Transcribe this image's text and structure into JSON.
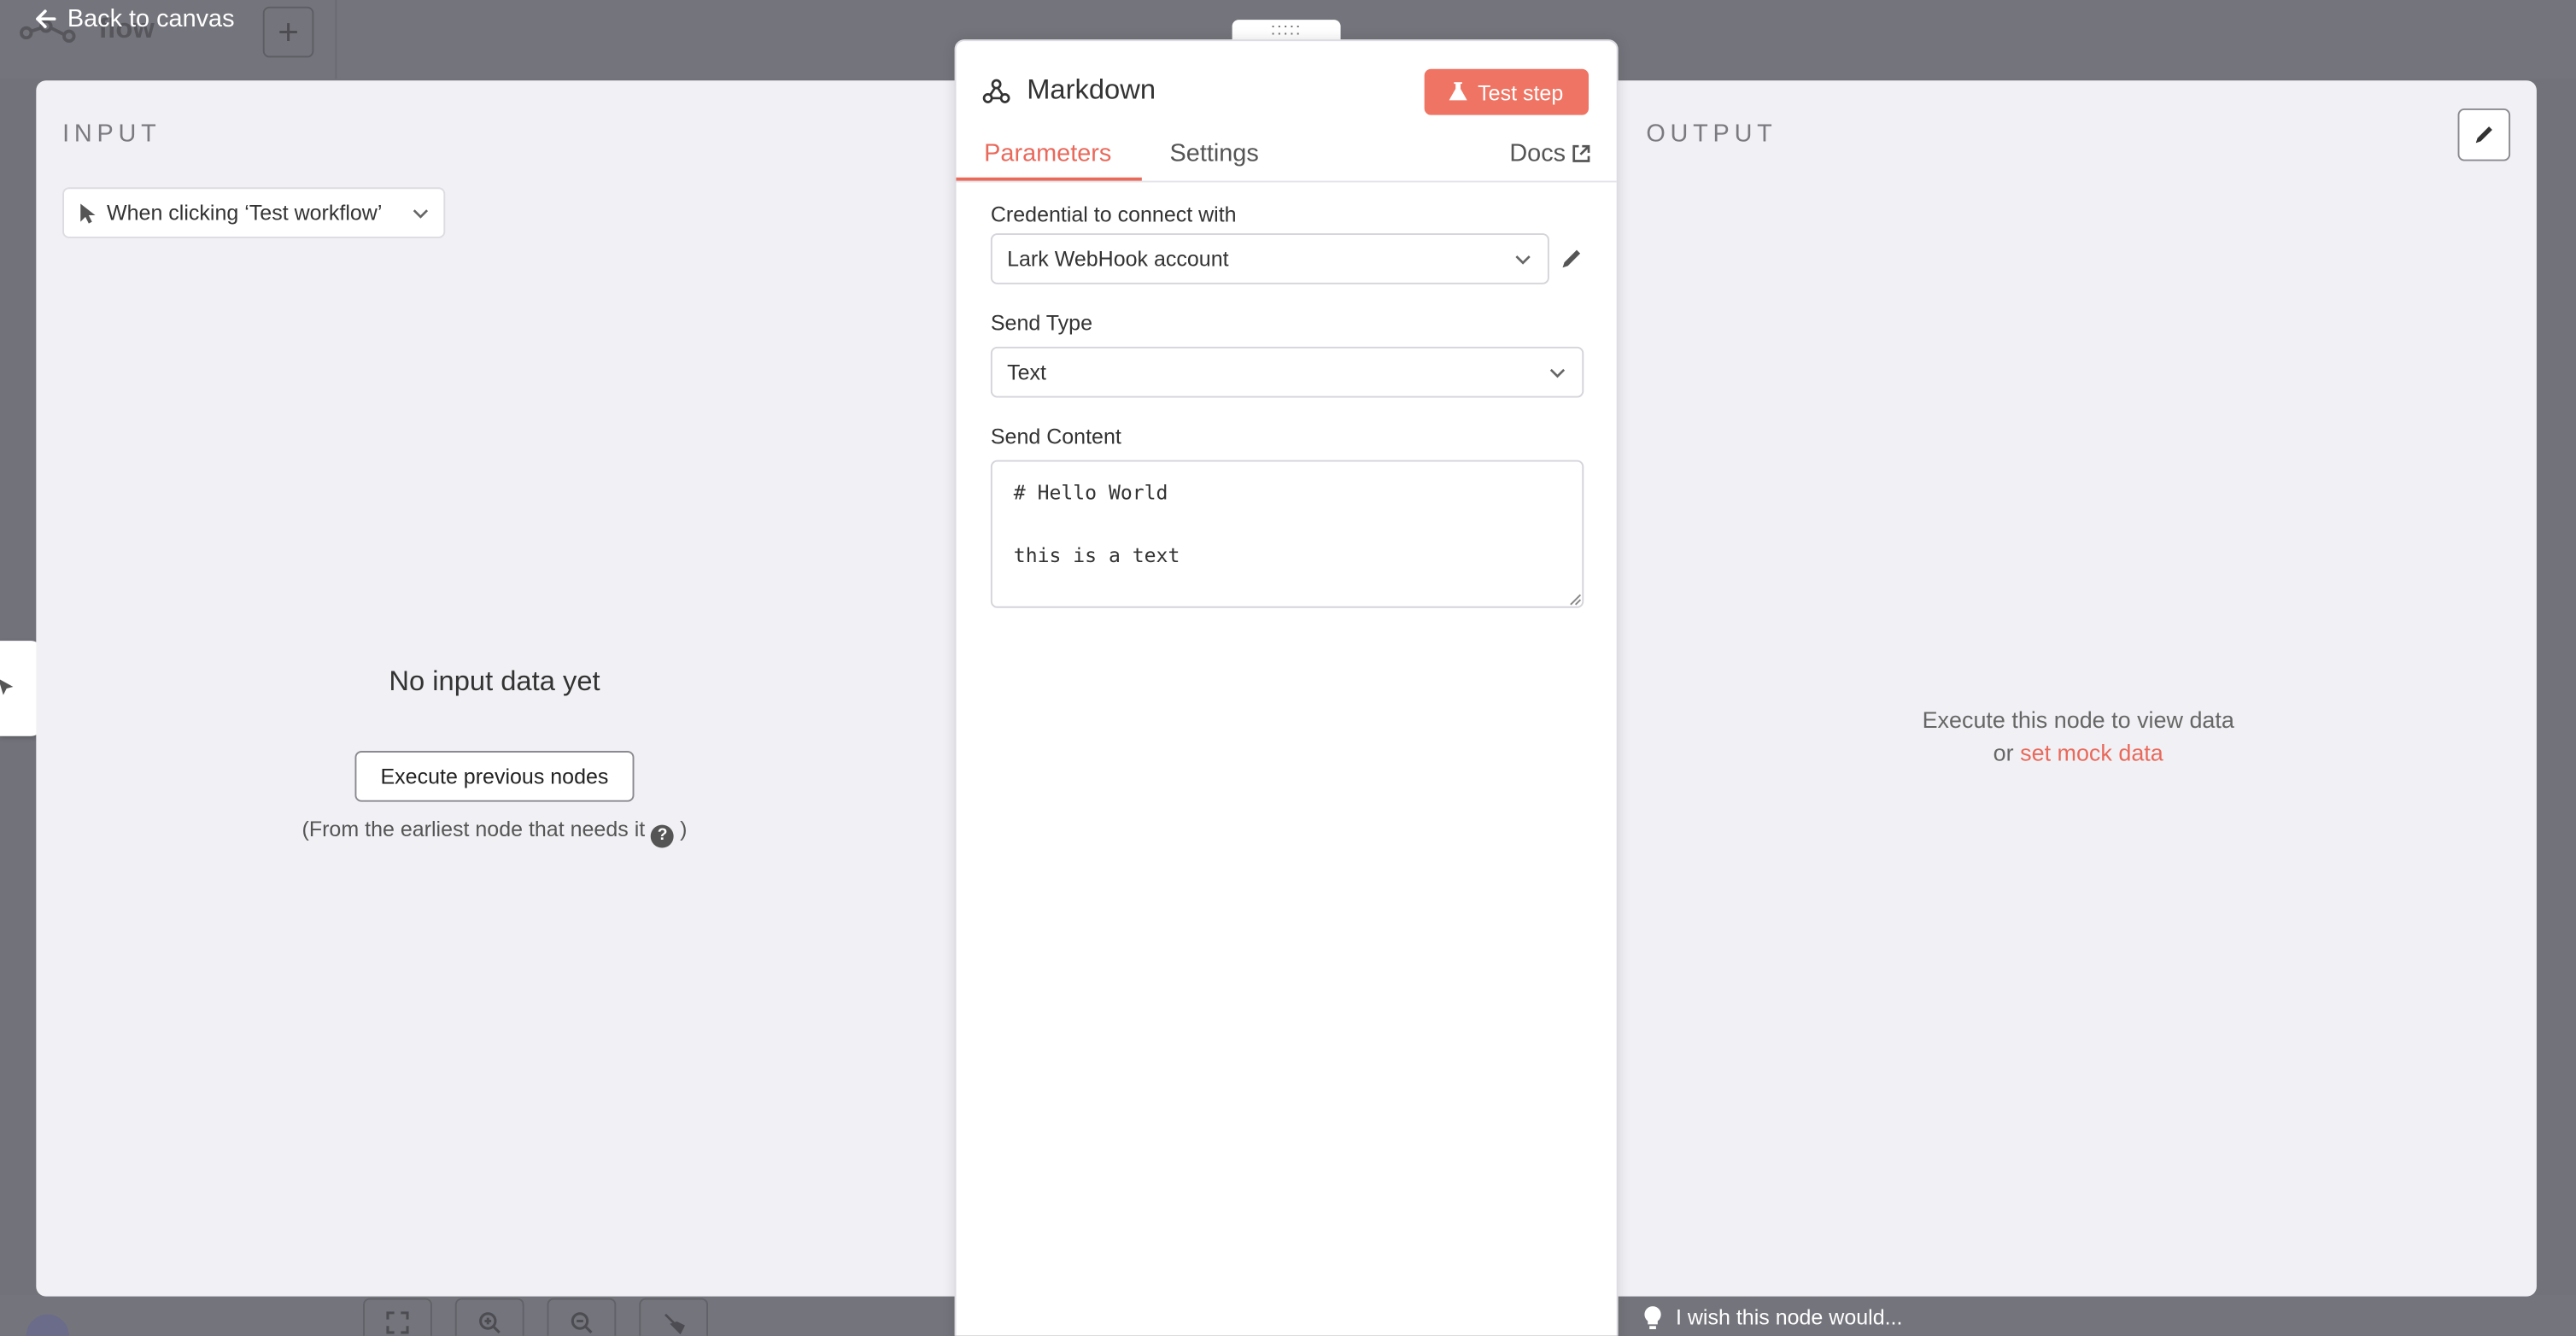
{
  "topbar": {
    "back_label": "Back to canvas",
    "ghost_title": "flow"
  },
  "input": {
    "label": "INPUT",
    "trigger_select": "When clicking ‘Test workflow’",
    "empty_title": "No input data yet",
    "execute_button": "Execute previous nodes",
    "note": "(From the earliest node that needs it",
    "note_end": ")"
  },
  "output": {
    "label": "OUTPUT",
    "message": "Execute this node to view data",
    "or": "or",
    "mock_link": "set mock data"
  },
  "node": {
    "title": "Markdown",
    "test_button": "Test step",
    "tabs": [
      "Parameters",
      "Settings"
    ],
    "docs": "Docs",
    "fields": {
      "credential_label": "Credential to connect with",
      "credential_value": "Lark WebHook account",
      "send_type_label": "Send Type",
      "send_type_value": "Text",
      "send_content_label": "Send Content",
      "send_content_value": "# Hello World\n\nthis is a text"
    }
  },
  "footer": {
    "wish": "I wish this node would..."
  },
  "colors": {
    "accent": "#ef7463",
    "link": "#e9695b",
    "overlay": "#72727b"
  }
}
